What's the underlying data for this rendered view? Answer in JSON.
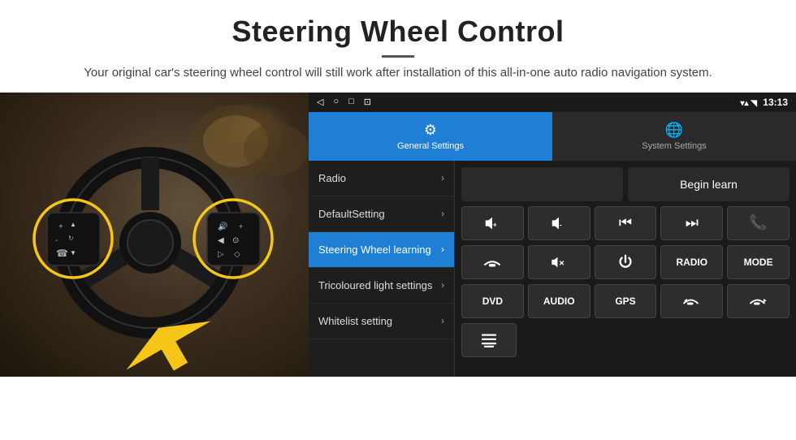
{
  "header": {
    "title": "Steering Wheel Control",
    "divider": true,
    "subtitle": "Your original car's steering wheel control will still work after installation of this all-in-one auto radio navigation system."
  },
  "status_bar": {
    "icons_left": [
      "back-icon",
      "home-icon",
      "square-icon",
      "cast-icon"
    ],
    "signal_icon": "signal",
    "wifi_icon": "wifi",
    "time": "13:13"
  },
  "tabs": [
    {
      "id": "general",
      "label": "General Settings",
      "active": true
    },
    {
      "id": "system",
      "label": "System Settings",
      "active": false
    }
  ],
  "menu_items": [
    {
      "id": "radio",
      "label": "Radio",
      "active": false
    },
    {
      "id": "default",
      "label": "DefaultSetting",
      "active": false
    },
    {
      "id": "steering",
      "label": "Steering Wheel learning",
      "active": true
    },
    {
      "id": "tricoloured",
      "label": "Tricoloured light settings",
      "active": false
    },
    {
      "id": "whitelist",
      "label": "Whitelist setting",
      "active": false
    }
  ],
  "controls": {
    "begin_learn_label": "Begin learn",
    "row1": [
      {
        "id": "vol_up",
        "symbol": "🔊+",
        "type": "icon"
      },
      {
        "id": "vol_down",
        "symbol": "🔊-",
        "type": "icon"
      },
      {
        "id": "prev_track",
        "symbol": "⏮",
        "type": "icon"
      },
      {
        "id": "next_track",
        "symbol": "⏭",
        "type": "icon"
      },
      {
        "id": "phone",
        "symbol": "📞",
        "type": "icon"
      }
    ],
    "row2": [
      {
        "id": "hang_up",
        "symbol": "📵",
        "type": "icon"
      },
      {
        "id": "mute",
        "symbol": "🔇x",
        "type": "icon"
      },
      {
        "id": "power",
        "symbol": "⏻",
        "type": "icon"
      },
      {
        "id": "radio_btn",
        "label": "RADIO",
        "type": "text"
      },
      {
        "id": "mode_btn",
        "label": "MODE",
        "type": "text"
      }
    ],
    "row3": [
      {
        "id": "dvd_btn",
        "label": "DVD",
        "type": "text"
      },
      {
        "id": "audio_btn",
        "label": "AUDIO",
        "type": "text"
      },
      {
        "id": "gps_btn",
        "label": "GPS",
        "type": "text"
      },
      {
        "id": "phone_prev",
        "symbol": "📞⏮",
        "type": "icon"
      },
      {
        "id": "phone_next",
        "symbol": "📞⏭",
        "type": "icon"
      }
    ],
    "row4_icon": "menu-icon"
  }
}
